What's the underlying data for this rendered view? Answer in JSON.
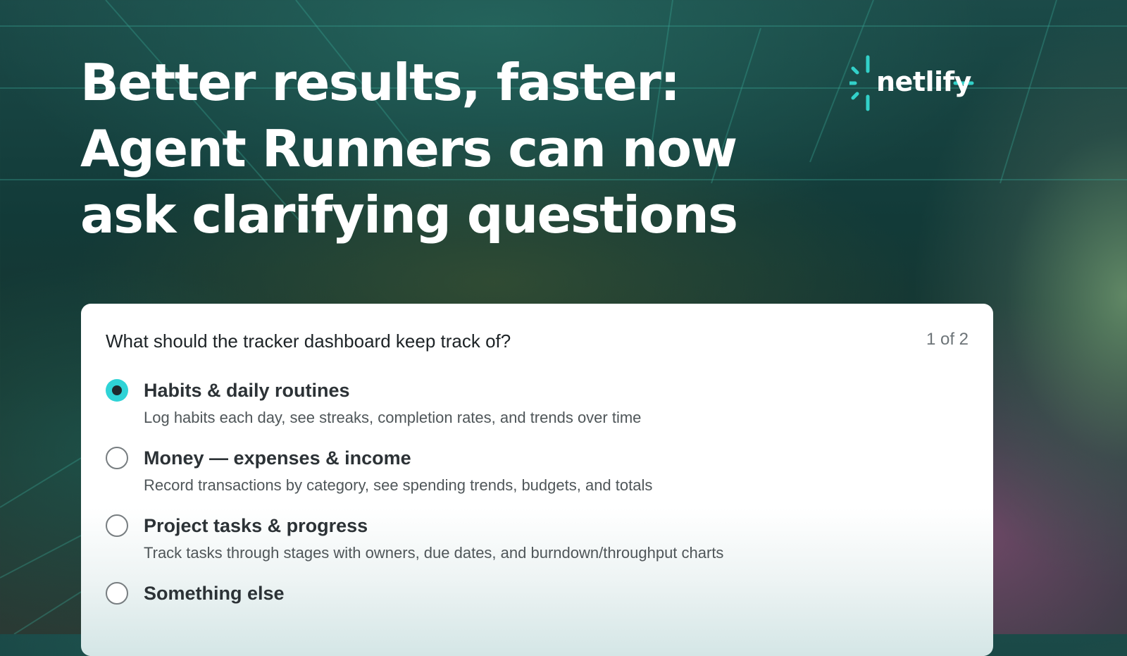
{
  "headline": {
    "line1": "Better results, faster:",
    "line2": "Agent Runners can now",
    "line3": "ask clarifying questions"
  },
  "brand": {
    "name": "netlify",
    "logo_icon": "netlify-logo-icon",
    "accent_color": "#32d1c9"
  },
  "card": {
    "question": "What should the tracker dashboard keep track of?",
    "counter": "1 of 2",
    "options": [
      {
        "title": "Habits & daily routines",
        "description": "Log habits each day, see streaks, completion rates, and trends over time",
        "selected": true
      },
      {
        "title": "Money — expenses & income",
        "description": "Record transactions by category, see spending trends, budgets, and totals",
        "selected": false
      },
      {
        "title": "Project tasks & progress",
        "description": "Track tasks through stages with owners, due dates, and burndown/throughput charts",
        "selected": false
      },
      {
        "title": "Something else",
        "selected": false
      }
    ],
    "radio_selected_color": "#2ed3d6"
  }
}
